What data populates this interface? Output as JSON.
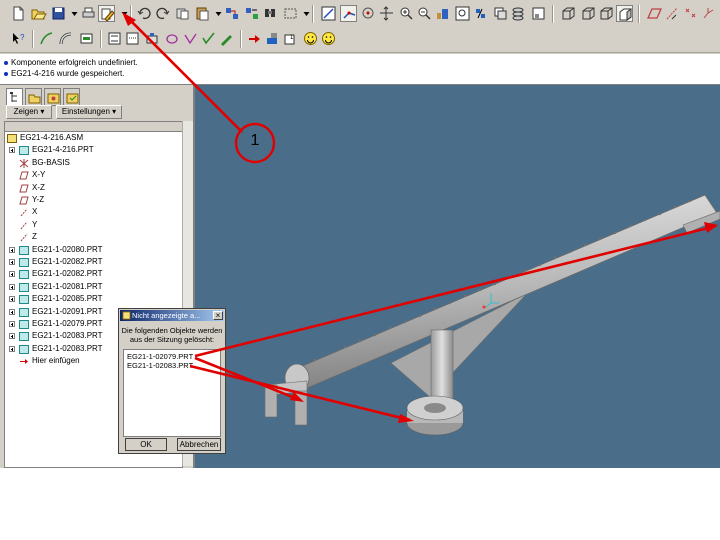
{
  "toolbar": {
    "top": [
      "new-icon",
      "open-icon",
      "save-icon",
      "save-dropdown-icon",
      "print-icon",
      "regenerate-icon",
      "regenerate-dropdown-icon",
      "undo-icon",
      "redo-icon",
      "cut-icon",
      "paste-icon",
      "paste-dropdown-icon",
      "copy-special-icon",
      "find-icon",
      "search-tool-icon",
      "select-box-icon",
      "select-dropdown-icon",
      "repaint-icon",
      "spin-center-icon",
      "orient-icon",
      "zoom-in-icon",
      "zoom-out-icon",
      "refit-icon",
      "view-manager-icon",
      "saved-views-icon",
      "layers-icon",
      "model-display-icon",
      "wireframe-icon",
      "hidden-line-icon",
      "no-hidden-icon",
      "shaded-icon",
      "datum-planes-icon",
      "datum-axes-icon",
      "datum-points-icon",
      "coord-sys-icon"
    ],
    "second": [
      "whats-this-icon",
      "sketch-icon",
      "pipe-icon",
      "view-icon",
      "dimension-icon",
      "sub-window-icon",
      "group-icon",
      "annotation-icon",
      "check-icon",
      "insert-arrow-icon",
      "assembly-icon",
      "info-icon",
      "smiley-icon",
      "smiley2-icon"
    ]
  },
  "messages": [
    "Komponente erfolgreich undefiniert.",
    "EG21-4-216 wurde gespeichert."
  ],
  "panel": {
    "show_button": "Zeigen ▾",
    "settings_button": "Einstellungen ▾"
  },
  "tree": {
    "items": [
      {
        "label": "EG21-4-216.ASM",
        "icon": "asm",
        "indent": 0,
        "expand": false
      },
      {
        "label": "EG21-4-216.PRT",
        "icon": "part",
        "indent": 1,
        "expand": true
      },
      {
        "label": "BG-BASIS",
        "icon": "csys",
        "indent": 1,
        "expand": false
      },
      {
        "label": "X-Y",
        "icon": "plane",
        "indent": 1,
        "expand": false
      },
      {
        "label": "X-Z",
        "icon": "plane",
        "indent": 1,
        "expand": false
      },
      {
        "label": "Y-Z",
        "icon": "plane",
        "indent": 1,
        "expand": false
      },
      {
        "label": "X",
        "icon": "axis",
        "indent": 1,
        "expand": false
      },
      {
        "label": "Y",
        "icon": "axis",
        "indent": 1,
        "expand": false
      },
      {
        "label": "Z",
        "icon": "axis",
        "indent": 1,
        "expand": false
      },
      {
        "label": "EG21-1-02080.PRT",
        "icon": "part",
        "indent": 1,
        "expand": true
      },
      {
        "label": "EG21-1-02082.PRT",
        "icon": "part",
        "indent": 1,
        "expand": true
      },
      {
        "label": "EG21-1-02082.PRT",
        "icon": "part",
        "indent": 1,
        "expand": true
      },
      {
        "label": "EG21-1-02081.PRT",
        "icon": "part",
        "indent": 1,
        "expand": true
      },
      {
        "label": "EG21-1-02085.PRT",
        "icon": "part",
        "indent": 1,
        "expand": true
      },
      {
        "label": "EG21-1-02091.PRT",
        "icon": "part",
        "indent": 1,
        "expand": true
      },
      {
        "label": "EG21-1-02079.PRT",
        "icon": "part",
        "indent": 1,
        "expand": true
      },
      {
        "label": "EG21-1-02083.PRT",
        "icon": "part",
        "indent": 1,
        "expand": true
      },
      {
        "label": "EG21-1-02083.PRT",
        "icon": "part",
        "indent": 1,
        "expand": true
      },
      {
        "label": "Hier einfügen",
        "icon": "insert",
        "indent": 1,
        "expand": false
      }
    ]
  },
  "dialog": {
    "title": "Nicht angezeigte a...",
    "close": "×",
    "description": "Die folgenden Objekte werden aus der Sitzung gelöscht:",
    "items": [
      "EG21-1-02079.PRT",
      "EG21-1-02083.PRT"
    ],
    "ok": "OK",
    "cancel": "Abbrechen"
  },
  "callout": {
    "number": "1"
  },
  "colors": {
    "viewport": "#4a6e8a",
    "annotation": "#e00000",
    "model": "#c8c8c8"
  }
}
